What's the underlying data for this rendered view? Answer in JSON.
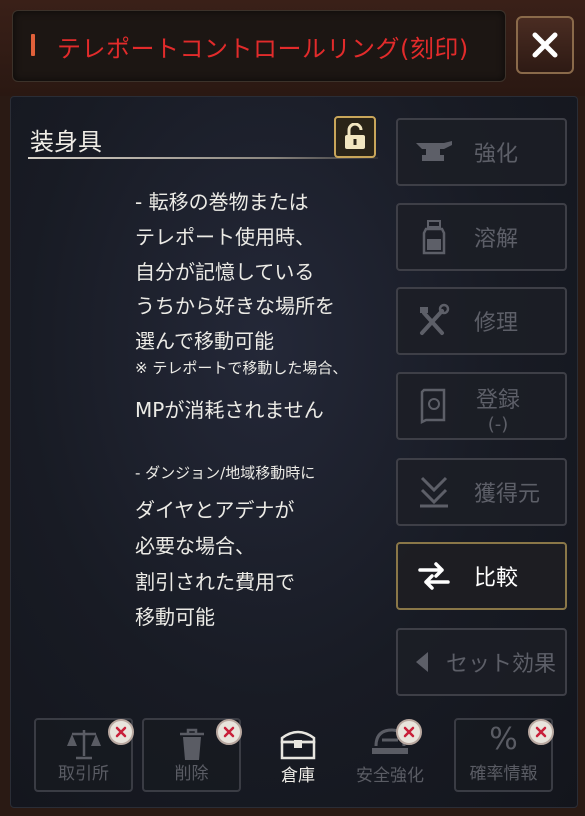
{
  "window": {
    "title": "テレポートコントロールリング(刻印)",
    "close_icon": "close-icon"
  },
  "section": {
    "title": "装身具",
    "lock_icon": "lock-open-icon"
  },
  "description": {
    "lines": [
      "- 転移の巻物または",
      "テレポート使用時、",
      "自分が記憶している",
      "うちから好きな場所を",
      "選んで移動可能",
      "※ テレポートで移動した場合、",
      "MPが消耗されません",
      "- ダンジョン/地域移動時に",
      "ダイヤとアデナが",
      "必要な場合、",
      "割引された費用で",
      "移動可能"
    ]
  },
  "side_buttons": [
    {
      "label": "強化",
      "icon": "anvil-icon",
      "enabled": false
    },
    {
      "label": "溶解",
      "icon": "potion-bottle-icon",
      "enabled": false
    },
    {
      "label": "修理",
      "icon": "tools-icon",
      "enabled": false
    },
    {
      "label": "登録",
      "sub": "(-)",
      "icon": "book-icon",
      "enabled": false
    },
    {
      "label": "獲得元",
      "icon": "source-arrow-icon",
      "enabled": false
    },
    {
      "label": "比較",
      "icon": "swap-arrows-icon",
      "enabled": true
    },
    {
      "label": "セット効果",
      "icon": "triangle-left-icon",
      "enabled": false
    }
  ],
  "bottom_buttons": [
    {
      "label": "取引所",
      "icon": "scales-icon",
      "disabled_badge": true
    },
    {
      "label": "削除",
      "icon": "trash-icon",
      "disabled_badge": true
    },
    {
      "label": "倉庫",
      "icon": "chest-icon",
      "disabled_badge": false
    },
    {
      "label": "安全強化",
      "icon": "safe-enhance-icon",
      "disabled_badge": true
    },
    {
      "label": "確率情報",
      "icon": "percent-icon",
      "disabled_badge": true
    }
  ],
  "colors": {
    "title_red": "#e22b2b",
    "accent_gold": "#c9a65a",
    "disabled_text": "#5d5f68",
    "active_text": "#ffffff"
  }
}
